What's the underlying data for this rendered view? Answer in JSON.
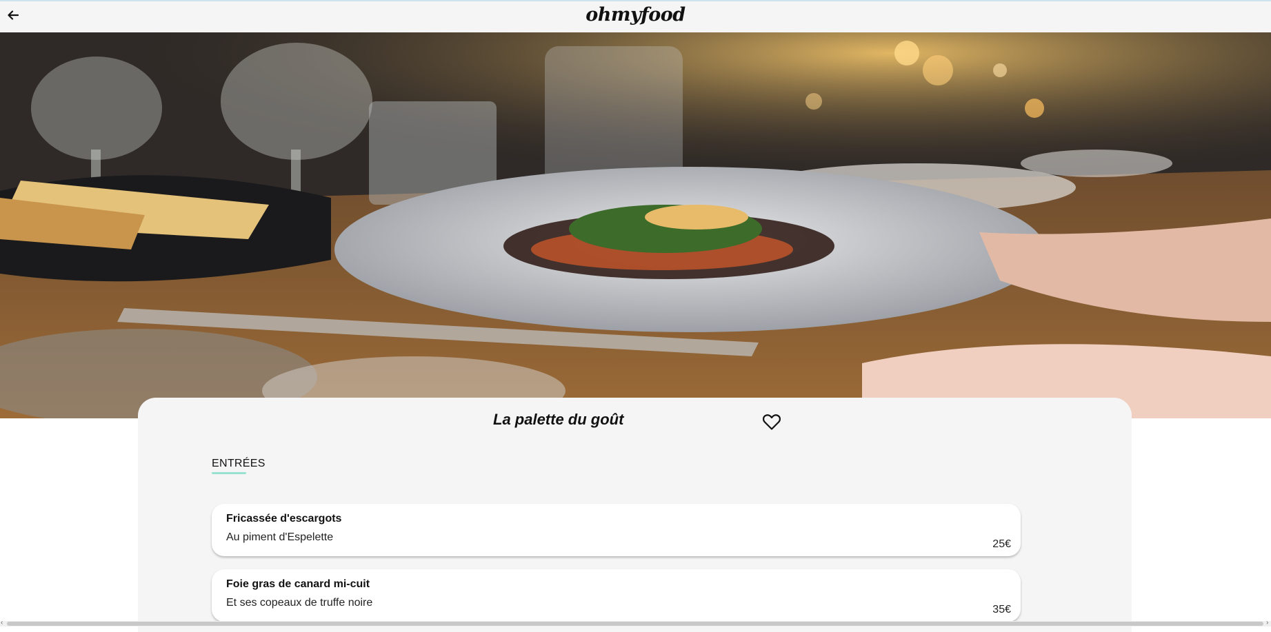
{
  "header": {
    "logo": "ohmyfood",
    "back_icon": "arrow-left-icon"
  },
  "hero": {
    "icon": "restaurant-photo"
  },
  "restaurant": {
    "name": "La palette du goût",
    "favorite_icon": "heart-outline-icon"
  },
  "menu": {
    "section_title": "ENTRÉES",
    "accent_color": "#99e2d0",
    "dishes": [
      {
        "name": "Fricassée d'escargots",
        "description": "Au piment d'Espelette",
        "price": "25€"
      },
      {
        "name": "Foie gras de canard mi-cuit",
        "description": "Et ses copeaux de truffe noire",
        "price": "35€"
      }
    ]
  }
}
